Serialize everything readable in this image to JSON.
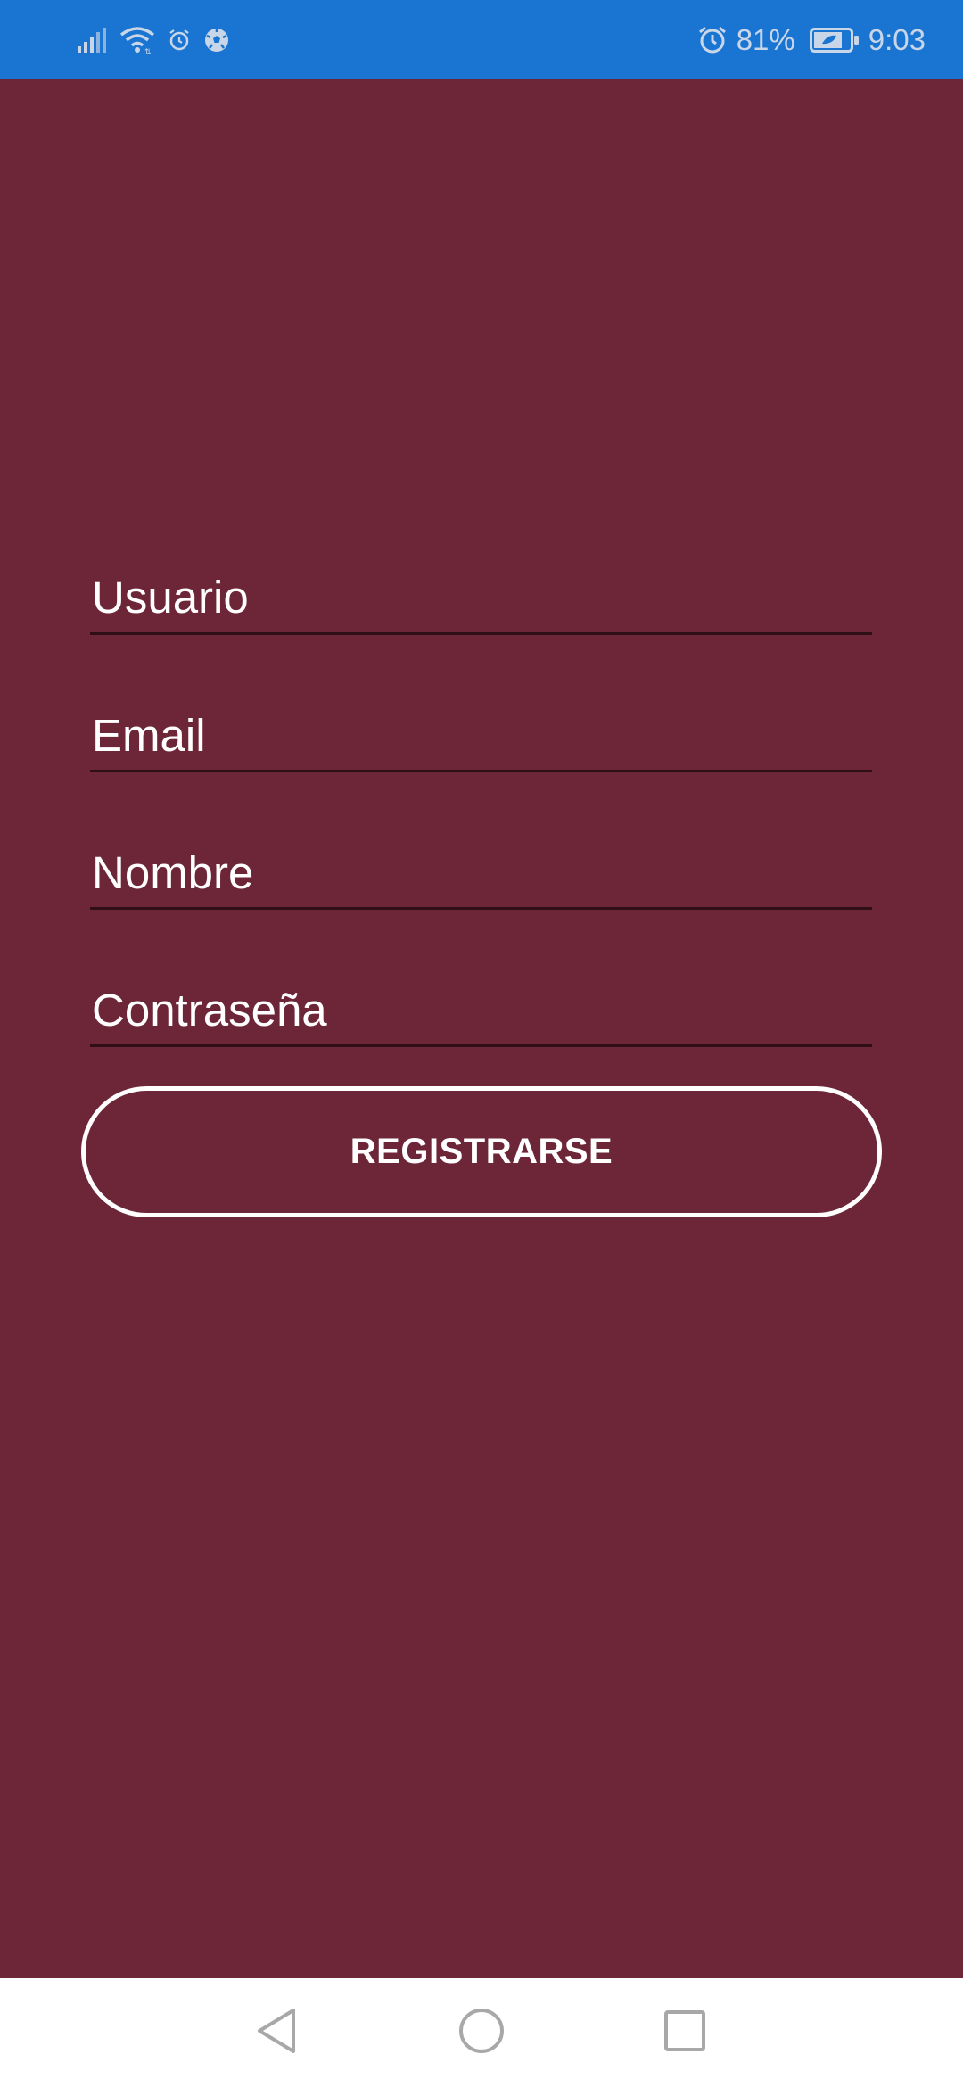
{
  "status_bar": {
    "battery_percent": "81%",
    "time": "9:03",
    "left_icons": [
      "signal-icon",
      "wifi-icon",
      "alarm-small-icon",
      "soccer-ball-icon"
    ],
    "right_icons": [
      "alarm-icon",
      "battery-icon"
    ],
    "background": "#1a75d2"
  },
  "form": {
    "background": "#6d2638",
    "fields": [
      {
        "label": "Usuario"
      },
      {
        "label": "Email"
      },
      {
        "label": "Nombre"
      },
      {
        "label": "Contraseña"
      }
    ],
    "register_label": "REGISTRARSE"
  },
  "nav_bar": {
    "buttons": [
      "back-icon",
      "home-icon",
      "recent-apps-icon"
    ]
  }
}
